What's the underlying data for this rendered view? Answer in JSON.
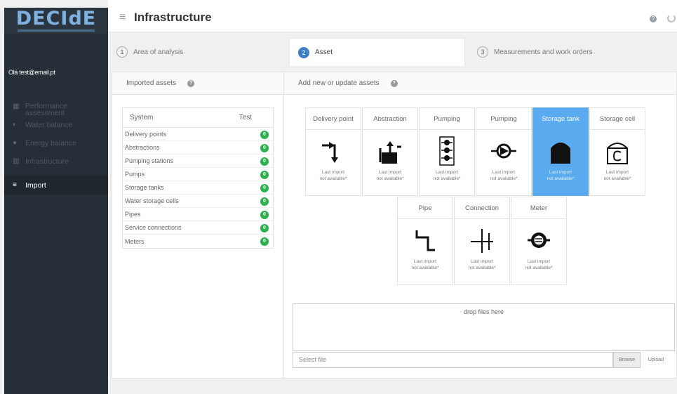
{
  "app": {
    "logo": "DECIdE",
    "user": "Olá test@email.pt"
  },
  "header": {
    "title": "Infrastructure",
    "help_glyph": "?"
  },
  "sidebar": {
    "items": [
      {
        "label": "Performance assessment",
        "icon": "chart-icon"
      },
      {
        "label": "Water balance",
        "icon": "water-icon"
      },
      {
        "label": "Energy balance",
        "icon": "energy-icon"
      },
      {
        "label": "Infrastructure",
        "icon": "infrastructure-icon"
      },
      {
        "label": "Import",
        "icon": "list-icon"
      }
    ]
  },
  "steps": [
    {
      "num": "1",
      "label": "Area of analysis"
    },
    {
      "num": "2",
      "label": "Asset"
    },
    {
      "num": "3",
      "label": "Measurements and work orders"
    }
  ],
  "imported": {
    "title": "Imported assets",
    "col_system": "System",
    "col_test": "Test",
    "rows": [
      {
        "name": "Delivery points",
        "count": "0"
      },
      {
        "name": "Abstractions",
        "count": "0"
      },
      {
        "name": "Pumping stations",
        "count": "0"
      },
      {
        "name": "Pumps",
        "count": "0"
      },
      {
        "name": "Storage tanks",
        "count": "0"
      },
      {
        "name": "Water storage cells",
        "count": "0"
      },
      {
        "name": "Pipes",
        "count": "0"
      },
      {
        "name": "Service connections",
        "count": "0"
      },
      {
        "name": "Meters",
        "count": "0"
      }
    ]
  },
  "assets_panel": {
    "title": "Add new or update assets",
    "note_line1": "Last import",
    "note_line2": "not available*",
    "cards": [
      {
        "label": "Delivery point",
        "icon": "delivery-point-icon"
      },
      {
        "label": "Abstraction",
        "icon": "abstraction-icon"
      },
      {
        "label": "Pumping",
        "icon": "pumping-station-icon"
      },
      {
        "label": "Pumping",
        "icon": "pump-icon"
      },
      {
        "label": "Storage tank",
        "icon": "storage-tank-icon"
      },
      {
        "label": "Storage cell",
        "icon": "storage-cell-icon"
      },
      {
        "label": "Pipe",
        "icon": "pipe-icon"
      },
      {
        "label": "Connection",
        "icon": "connection-icon"
      },
      {
        "label": "Meter",
        "icon": "meter-icon"
      }
    ],
    "selected": "Storage tank",
    "selected_color": "#5aaaf0"
  },
  "upload": {
    "dropzone": "drop files here",
    "placeholder": "Select file",
    "browse": "Browse",
    "upload": "Upload"
  },
  "colors": {
    "sidebar": "#262f37",
    "accent": "#3d7fc6",
    "success": "#2cb24c"
  }
}
